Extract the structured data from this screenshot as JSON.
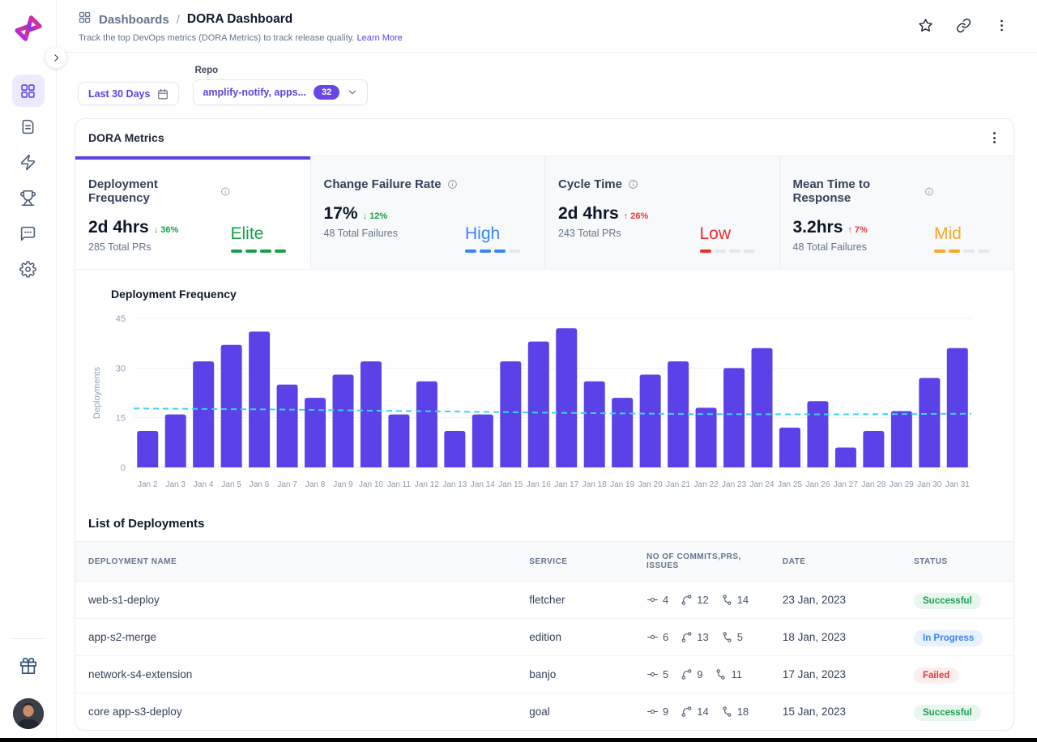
{
  "header": {
    "breadcrumb_section": "Dashboards",
    "breadcrumb_separator": "/",
    "breadcrumb_page": "DORA Dashboard",
    "subtitle": "Track the top DevOps metrics (DORA Metrics) to track release quality.",
    "learn_more_label": "Learn More",
    "action_icons": [
      "star-icon",
      "link-icon",
      "kebab-menu-icon"
    ]
  },
  "sidebar": {
    "items": [
      {
        "name": "dashboards",
        "icon": "grid-icon",
        "active": true
      },
      {
        "name": "documents",
        "icon": "file-icon",
        "active": false
      },
      {
        "name": "activity",
        "icon": "lightning-icon",
        "active": false
      },
      {
        "name": "achievements",
        "icon": "trophy-icon",
        "active": false
      },
      {
        "name": "feedback",
        "icon": "chat-icon",
        "active": false
      },
      {
        "name": "settings",
        "icon": "gear-icon",
        "active": false
      },
      {
        "name": "rewards",
        "icon": "gift-icon",
        "active": false
      },
      {
        "name": "profile",
        "icon": "avatar",
        "active": false
      }
    ]
  },
  "filters": {
    "date_range_value": "Last 30 Days",
    "repo_label": "Repo",
    "repo_value": "amplify-notify, apps...",
    "repo_count": "32"
  },
  "panel": {
    "title": "DORA Metrics"
  },
  "metrics": {
    "cards": [
      {
        "title": "Deployment Frequency",
        "value": "2d 4hrs",
        "delta": "36%",
        "delta_dir": "down",
        "delta_good": true,
        "sub": "285 Total PRs",
        "rating": "Elite",
        "rating_color": "#17a24a",
        "dashes_filled": 4,
        "dashes_total": 4,
        "active": true
      },
      {
        "title": "Change Failure Rate",
        "value": "17%",
        "delta": "12%",
        "delta_dir": "down",
        "delta_good": true,
        "sub": "48 Total Failures",
        "rating": "High",
        "rating_color": "#3c83f6",
        "dashes_filled": 3,
        "dashes_total": 4,
        "active": false
      },
      {
        "title": "Cycle Time",
        "value": "2d 4hrs",
        "delta": "26%",
        "delta_dir": "up",
        "delta_good": false,
        "sub": "243 Total PRs",
        "rating": "Low",
        "rating_color": "#f32b2b",
        "dashes_filled": 1,
        "dashes_total": 4,
        "active": false
      },
      {
        "title": "Mean Time to Response",
        "value": "3.2hrs",
        "delta": "7%",
        "delta_dir": "up",
        "delta_good": false,
        "sub": "48 Total Failures",
        "rating": "Mid",
        "rating_color": "#f7a823",
        "dashes_filled": 2,
        "dashes_total": 4,
        "active": false
      }
    ]
  },
  "chart_data": {
    "type": "bar",
    "title": "Deployment Frequency",
    "xlabel": "",
    "ylabel": "Deployments",
    "ylim": [
      0,
      45
    ],
    "yticks": [
      0,
      15,
      30,
      45
    ],
    "grid": true,
    "bar_color": "#5b42e8",
    "trend_color": "#3bd3f2",
    "categories": [
      "Jan 2",
      "Jan 3",
      "Jan 4",
      "Jan 5",
      "Jan 6",
      "Jan 7",
      "Jan 8",
      "Jan 9",
      "Jan 10",
      "Jan 11",
      "Jan 12",
      "Jan 13",
      "Jan 14",
      "Jan 15",
      "Jan 16",
      "Jan 17",
      "Jan 18",
      "Jan 19",
      "Jan 20",
      "Jan 21",
      "Jan 22",
      "Jan 23",
      "Jan 24",
      "Jan 25",
      "Jan 26",
      "Jan 27",
      "Jan 28",
      "Jan 29",
      "Jan 30",
      "Jan 31"
    ],
    "values": [
      11,
      16,
      32,
      37,
      41,
      25,
      21,
      28,
      32,
      16,
      26,
      11,
      16,
      32,
      38,
      42,
      26,
      21,
      28,
      32,
      18,
      30,
      36,
      12,
      20,
      6,
      11,
      17,
      27,
      36
    ],
    "trend_line": {
      "name": "average",
      "style": "dashed",
      "values": [
        17.8,
        17.5,
        17.0,
        16.5,
        16.1,
        16.0,
        16.2
      ]
    }
  },
  "table": {
    "title": "List of Deployments",
    "columns": [
      "Deployment Name",
      "Service",
      "No of Commits,PRs, Issues",
      "Date",
      "Status"
    ],
    "rows": [
      {
        "name": "web-s1-deploy",
        "service": "fletcher",
        "commits": 4,
        "prs": 12,
        "issues": 14,
        "date": "23 Jan, 2023",
        "status": "Successful",
        "status_type": "success"
      },
      {
        "name": "app-s2-merge",
        "service": "edition",
        "commits": 6,
        "prs": 13,
        "issues": 5,
        "date": "18 Jan, 2023",
        "status": "In Progress",
        "status_type": "progress"
      },
      {
        "name": "network-s4-extension",
        "service": "banjo",
        "commits": 5,
        "prs": 9,
        "issues": 11,
        "date": "17 Jan, 2023",
        "status": "Failed",
        "status_type": "failed"
      },
      {
        "name": "core app-s3-deploy",
        "service": "goal",
        "commits": 9,
        "prs": 14,
        "issues": 18,
        "date": "15 Jan, 2023",
        "status": "Successful",
        "status_type": "success"
      }
    ]
  },
  "colors": {
    "accent": "#5b42e8",
    "success": "#1a9e50",
    "in_progress": "#3c83f6",
    "failed": "#dd3c3c"
  }
}
